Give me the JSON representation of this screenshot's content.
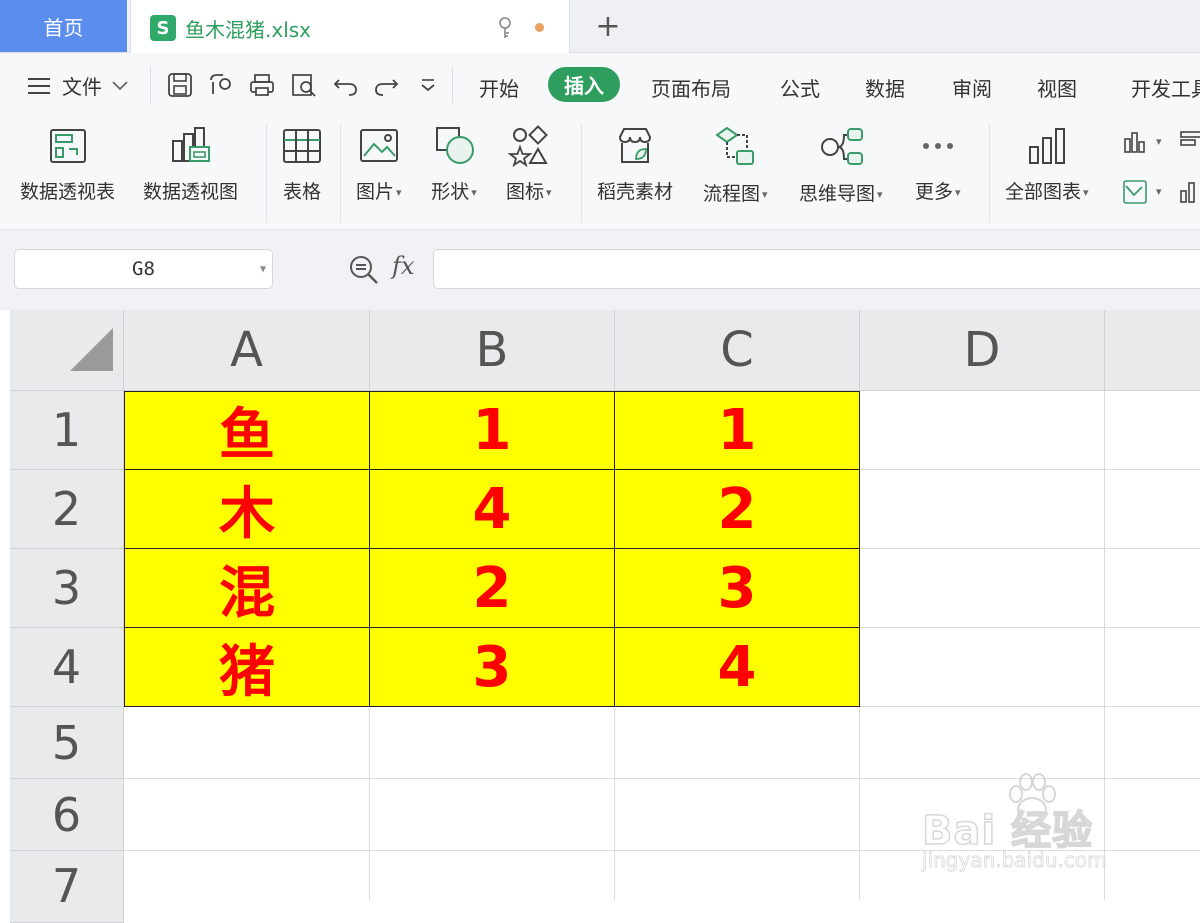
{
  "tabs": {
    "home": "首页",
    "file": "鱼木混猪.xlsx"
  },
  "menu": {
    "file": "文件",
    "tabs": [
      "开始",
      "插入",
      "页面布局",
      "公式",
      "数据",
      "审阅",
      "视图",
      "开发工具"
    ],
    "active": "插入"
  },
  "ribbon": {
    "items": [
      {
        "label": "数据透视表",
        "icon": "pivot-table-icon"
      },
      {
        "label": "数据透视图",
        "icon": "pivot-chart-icon"
      },
      {
        "label": "表格",
        "icon": "table-icon"
      },
      {
        "label": "图片",
        "icon": "picture-icon"
      },
      {
        "label": "形状",
        "icon": "shape-icon"
      },
      {
        "label": "图标",
        "icon": "icons-icon"
      },
      {
        "label": "稻壳素材",
        "icon": "docer-material-icon"
      },
      {
        "label": "流程图",
        "icon": "flowchart-icon"
      },
      {
        "label": "思维导图",
        "icon": "mindmap-icon"
      },
      {
        "label": "更多",
        "icon": "more-icon"
      },
      {
        "label": "全部图表",
        "icon": "all-charts-icon"
      }
    ]
  },
  "formula_bar": {
    "name_box": "G8",
    "fx": "fx",
    "formula": ""
  },
  "sheet": {
    "columns": [
      "A",
      "B",
      "C",
      "D"
    ],
    "rows": [
      "1",
      "2",
      "3",
      "4",
      "5",
      "6",
      "7"
    ],
    "cells": [
      [
        "鱼",
        "1",
        "1"
      ],
      [
        "木",
        "4",
        "2"
      ],
      [
        "混",
        "2",
        "3"
      ],
      [
        "猪",
        "3",
        "4"
      ]
    ],
    "fill_color": "#ffff00",
    "text_color": "#ff0000"
  },
  "watermark": {
    "main": "Bai 经验",
    "sub": "jingyan.baidu.com"
  },
  "colors": {
    "accent_green": "#2e9e5e",
    "home_tab_blue": "#5b8def"
  }
}
